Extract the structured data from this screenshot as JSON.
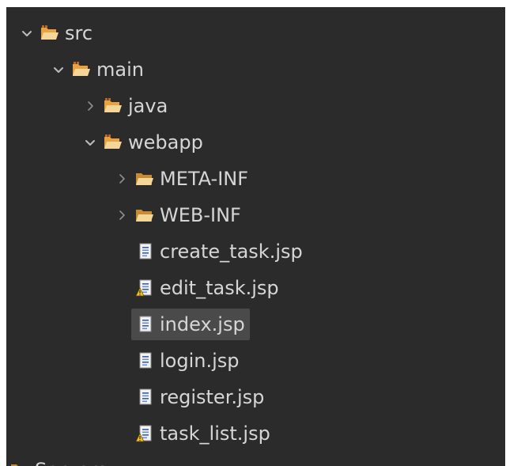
{
  "tree": {
    "items": [
      {
        "label": "src",
        "level": 0,
        "kind": "pkg-folder",
        "expanded": true
      },
      {
        "label": "main",
        "level": 1,
        "kind": "pkg-folder",
        "expanded": true
      },
      {
        "label": "java",
        "level": 2,
        "kind": "pkg-folder",
        "expanded": false
      },
      {
        "label": "webapp",
        "level": 2,
        "kind": "pkg-folder",
        "expanded": true
      },
      {
        "label": "META-INF",
        "level": 3,
        "kind": "folder",
        "expanded": false
      },
      {
        "label": "WEB-INF",
        "level": 3,
        "kind": "folder",
        "expanded": false
      },
      {
        "label": "create_task.jsp",
        "level": 3,
        "kind": "file"
      },
      {
        "label": "edit_task.jsp",
        "level": 3,
        "kind": "file-warning"
      },
      {
        "label": "index.jsp",
        "level": 3,
        "kind": "file",
        "selected": true
      },
      {
        "label": "login.jsp",
        "level": 3,
        "kind": "file"
      },
      {
        "label": "register.jsp",
        "level": 3,
        "kind": "file"
      },
      {
        "label": "task_list.jsp",
        "level": 3,
        "kind": "file-warning"
      }
    ],
    "partial": {
      "label": "Servers",
      "kind": "folder"
    }
  },
  "colors": {
    "background": "#2b2b2b",
    "text": "#d6d6d6",
    "selection": "#4a4a4a",
    "chevron": "#bdbdbd",
    "folder": "#e8a33d",
    "folder_light": "#f4d59a"
  }
}
